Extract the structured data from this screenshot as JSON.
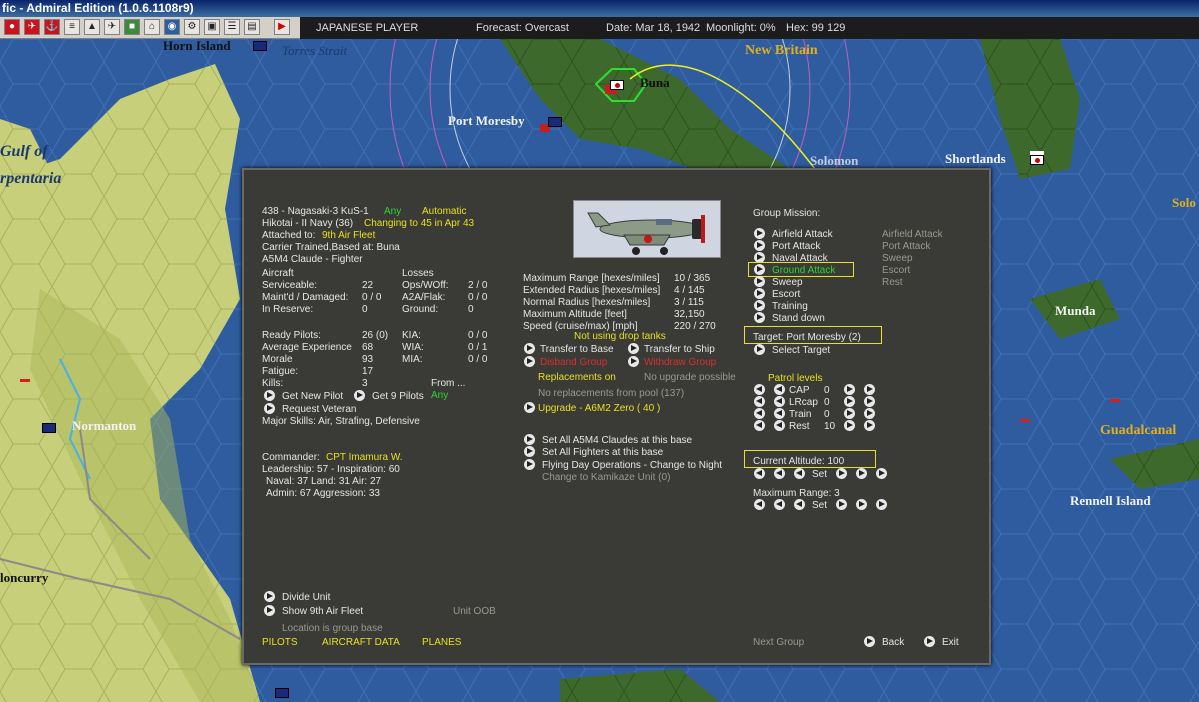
{
  "window": {
    "title": "fic - Admiral Edition (1.0.6.1108r9)"
  },
  "status": {
    "player": "JAPANESE PLAYER",
    "forecast": "Forecast: Overcast",
    "date": "Date: Mar 18, 1942",
    "moonlight": "Moonlight: 0%",
    "hex": "Hex: 99 129"
  },
  "map": {
    "labels": {
      "horn": "Horn Island",
      "torres": "Torres Strait",
      "newbritain": "New Britain",
      "buna": "Buna",
      "portmoresby": "Port Moresby",
      "gulf1": "Gulf of",
      "gulf2": "rpentaria",
      "shortlands": "Shortlands",
      "solomon": "Solomon",
      "solo": "Solo",
      "munda": "Munda",
      "normanton": "Normanton",
      "guadalcanal": "Guadalcanal",
      "rennell": "Rennell Island",
      "cloncurry": "loncurry"
    }
  },
  "group": {
    "line1": "438 - Nagasaki-3 KuS-1",
    "any": "Any",
    "automatic": "Automatic",
    "line2": "Hikotai - II Navy (36)",
    "changing": "Changing to 45 in Apr 43",
    "attached_label": "Attached to:",
    "attached": "9th Air Fleet",
    "carrier": "Carrier Trained,Based at: Buna",
    "aircraft_type": "A5M4 Claude - Fighter"
  },
  "aircraft": {
    "header": "Aircraft",
    "losses_header": "Losses",
    "serviceable_label": "Serviceable:",
    "serviceable": "22",
    "maintd_label": "Maint'd / Damaged:",
    "maintd": "0 / 0",
    "reserve_label": "In Reserve:",
    "reserve": "0",
    "opsw_label": "Ops/WOff:",
    "opsw": "2 / 0",
    "a2a_label": "A2A/Flak:",
    "a2a": "0 / 0",
    "ground_label": "Ground:",
    "ground": "0"
  },
  "pilots": {
    "ready_label": "Ready Pilots:",
    "ready": "26 (0)",
    "exp_label": "Average Experience",
    "exp": "68",
    "morale_label": "Morale",
    "morale": "93",
    "fatigue_label": "Fatigue:",
    "fatigue": "17",
    "kills_label": "Kills:",
    "kills": "3",
    "kia_label": "KIA:",
    "kia": "0 / 0",
    "wia_label": "WIA:",
    "wia": "0 / 1",
    "mia_label": "MIA:",
    "mia": "0 / 0",
    "from_label": "From ...",
    "from_val": "Any",
    "get_new": "Get New Pilot",
    "get_9": "Get 9 Pilots",
    "req_vet": "Request Veteran",
    "skills": "Major Skills: Air, Strafing, Defensive"
  },
  "commander": {
    "label": "Commander:",
    "name": "CPT Imamura W.",
    "line1": "Leadership: 57 - Inspiration: 60",
    "line2": "Naval: 37  Land: 31  Air: 27",
    "line3": "Admin: 67  Aggression: 33"
  },
  "specs": {
    "max_range_label": "Maximum Range [hexes/miles]",
    "max_range": "10 / 365",
    "ext_label": "Extended Radius [hexes/miles]",
    "ext": "4 / 145",
    "norm_label": "Normal Radius [hexes/miles]",
    "norm": "3 / 115",
    "alt_label": "Maximum Altitude [feet]",
    "alt": "32,150",
    "speed_label": "Speed (cruise/max) [mph]",
    "speed": "220 / 270",
    "drop_tanks": "Not using drop tanks"
  },
  "actions": {
    "transfer_base": "Transfer to Base",
    "transfer_ship": "Transfer to Ship",
    "disband": "Disband Group",
    "withdraw": "Withdraw Group",
    "repl_on": "Replacements on",
    "no_upgrade": "No upgrade possible",
    "no_repl": "No replacements from pool (137)",
    "upgrade": "Upgrade - A6M2 Zero  ( 40 )",
    "set_all_claudes": "Set All A5M4 Claudes at this base",
    "set_all_fighters": "Set All Fighters at this base",
    "flying_day": "Flying Day Operations - Change to Night",
    "kamikaze": "Change to Kamikaze Unit (0)"
  },
  "mission": {
    "header": "Group Mission:",
    "items": [
      "Airfield Attack",
      "Port Attack",
      "Naval Attack",
      "Ground Attack",
      "Sweep",
      "Escort",
      "Training",
      "Stand down"
    ],
    "secondary": [
      "Airfield Attack",
      "Port Attack",
      "Sweep",
      "Escort",
      "Rest"
    ],
    "target": "Target: Port Moresby  (2)",
    "select_target": "Select Target"
  },
  "patrol": {
    "header": "Patrol levels",
    "rows": [
      {
        "label": "CAP",
        "value": "0"
      },
      {
        "label": "LRcap",
        "value": "0"
      },
      {
        "label": "Train",
        "value": "0"
      },
      {
        "label": "Rest",
        "value": "10"
      }
    ]
  },
  "altitude": {
    "current": "Current Altitude: 100",
    "set": "Set",
    "maxrange": "Maximum Range: 3"
  },
  "footer": {
    "divide": "Divide Unit",
    "show": "Show 9th Air Fleet",
    "oob": "Unit OOB",
    "location": "Location is group base",
    "tab_pilots": "PILOTS",
    "tab_aircraft": "AIRCRAFT DATA",
    "tab_planes": "PLANES",
    "next": "Next Group",
    "back": "Back",
    "exit": "Exit"
  }
}
